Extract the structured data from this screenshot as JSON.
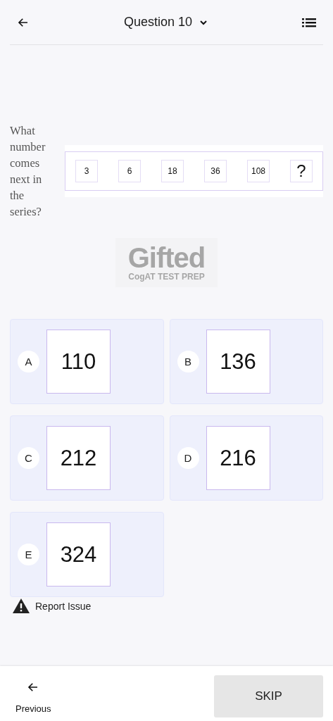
{
  "header": {
    "title": "Question 10"
  },
  "question": {
    "text": "What number comes next in the series?",
    "series": [
      "3",
      "6",
      "18",
      "36",
      "108",
      "?"
    ]
  },
  "logo": {
    "name": "Gifted",
    "tagline": "CogAT TEST PREP"
  },
  "options": [
    {
      "letter": "A",
      "value": "110",
      "selected": false
    },
    {
      "letter": "B",
      "value": "136",
      "selected": false
    },
    {
      "letter": "C",
      "value": "212",
      "selected": false
    },
    {
      "letter": "D",
      "value": "216",
      "selected": false
    },
    {
      "letter": "E",
      "value": "324",
      "selected": false
    }
  ],
  "report": {
    "label": "Report Issue"
  },
  "footer": {
    "previous": "Previous",
    "skip": "SKIP"
  }
}
